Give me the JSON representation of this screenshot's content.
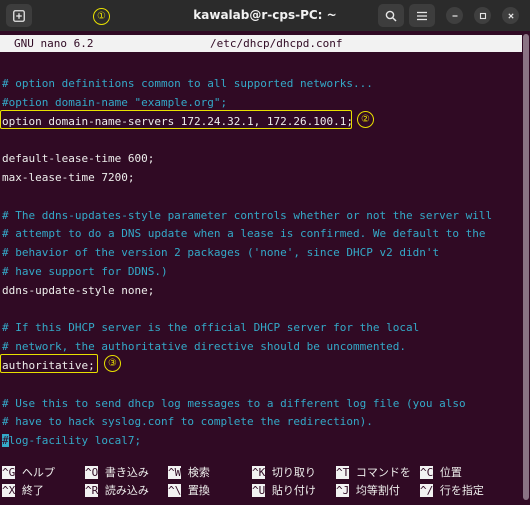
{
  "window": {
    "title": "kawalab@r-cps-PC: ~"
  },
  "annotations": [
    "①",
    "②",
    "③"
  ],
  "nano": {
    "version": "GNU nano 6.2",
    "filename": "/etc/dhcp/dhcpd.conf"
  },
  "lines": [
    {
      "text": "# option definitions common to all supported networks...",
      "comment": true
    },
    {
      "text": "#option domain-name \"example.org\";",
      "comment": true
    },
    {
      "text": "option domain-name-servers 172.24.32.1, 172.26.100.1;",
      "comment": false
    },
    {
      "text": "",
      "comment": false
    },
    {
      "text": "default-lease-time 600;",
      "comment": false
    },
    {
      "text": "max-lease-time 7200;",
      "comment": false
    },
    {
      "text": "",
      "comment": false
    },
    {
      "text": "# The ddns-updates-style parameter controls whether or not the server will",
      "comment": true
    },
    {
      "text": "# attempt to do a DNS update when a lease is confirmed. We default to the",
      "comment": true
    },
    {
      "text": "# behavior of the version 2 packages ('none', since DHCP v2 didn't",
      "comment": true
    },
    {
      "text": "# have support for DDNS.)",
      "comment": true
    },
    {
      "text": "ddns-update-style none;",
      "comment": false
    },
    {
      "text": "",
      "comment": false
    },
    {
      "text": "# If this DHCP server is the official DHCP server for the local",
      "comment": true
    },
    {
      "text": "# network, the authoritative directive should be uncommented.",
      "comment": true
    },
    {
      "text": "authoritative;",
      "comment": false
    },
    {
      "text": "",
      "comment": false
    },
    {
      "text": "# Use this to send dhcp log messages to a different log file (you also",
      "comment": true
    },
    {
      "text": "# have to hack syslog.conf to complete the redirection).",
      "comment": true
    },
    {
      "text": "#log-facility local7;",
      "comment": true
    }
  ],
  "shortcuts": [
    [
      {
        "key": "^G",
        "label": "ヘルプ"
      },
      {
        "key": "^O",
        "label": "書き込み"
      },
      {
        "key": "^W",
        "label": "検索"
      },
      {
        "key": "^K",
        "label": "切り取り"
      },
      {
        "key": "^T",
        "label": "コマンドを"
      },
      {
        "key": "^C",
        "label": "位置"
      }
    ],
    [
      {
        "key": "^X",
        "label": "終了"
      },
      {
        "key": "^R",
        "label": "読み込み"
      },
      {
        "key": "^\\",
        "label": "置換"
      },
      {
        "key": "^U",
        "label": "貼り付け"
      },
      {
        "key": "^J",
        "label": "均等割付"
      },
      {
        "key": "^/",
        "label": "行を指定"
      }
    ]
  ]
}
